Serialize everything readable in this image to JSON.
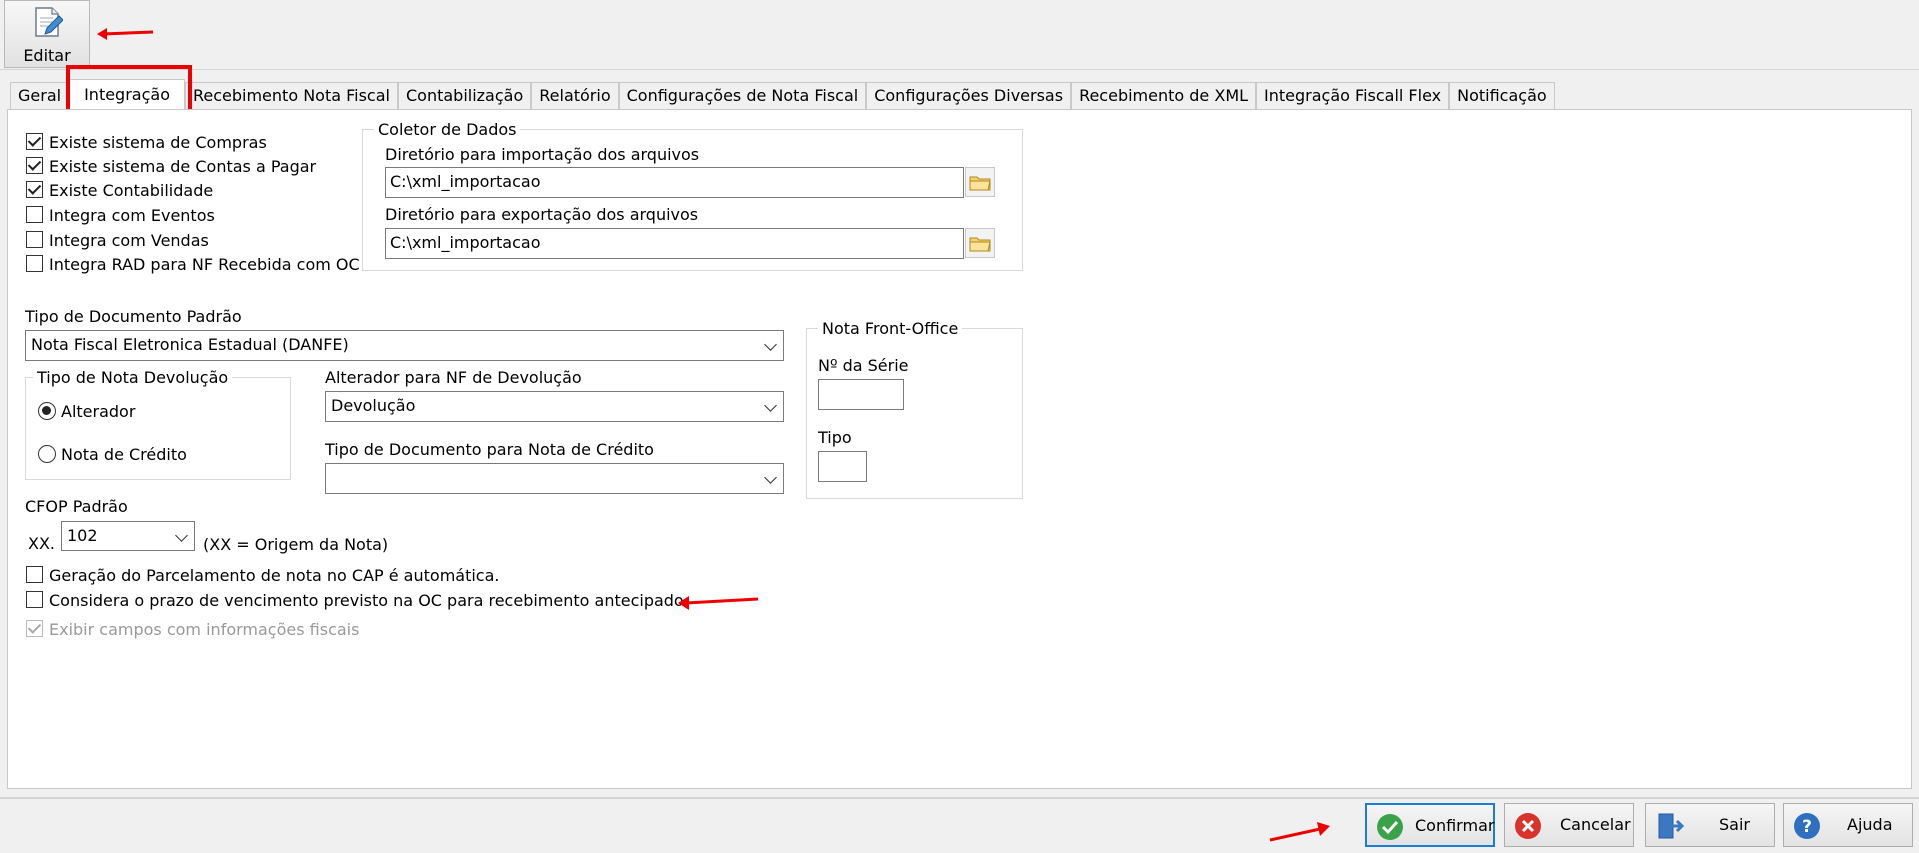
{
  "toolbar": {
    "edit_label": "Editar"
  },
  "tabs": [
    "Geral",
    "Integração",
    "Recebimento Nota Fiscal",
    "Contabilização",
    "Relatório",
    "Configurações de Nota Fiscal",
    "Configurações Diversas",
    "Recebimento de XML",
    "Integração Fiscall Flex",
    "Notificação"
  ],
  "checks": [
    {
      "label": "Existe sistema de Compras",
      "checked": true
    },
    {
      "label": "Existe sistema de Contas a Pagar",
      "checked": true
    },
    {
      "label": "Existe Contabilidade",
      "checked": true
    },
    {
      "label": "Integra com Eventos",
      "checked": false
    },
    {
      "label": "Integra com Vendas",
      "checked": false
    },
    {
      "label": "Integra RAD para NF Recebida com OC",
      "checked": false
    }
  ],
  "coletor": {
    "legend": "Coletor de Dados",
    "import_label": "Diretório para importação dos arquivos",
    "import_value": "C:\\xml_importacao",
    "export_label": "Diretório para exportação dos arquivos",
    "export_value": "C:\\xml_importacao"
  },
  "tipo_doc": {
    "label": "Tipo de Documento Padrão",
    "value": "Nota Fiscal Eletronica Estadual (DANFE)"
  },
  "devolucao": {
    "legend": "Tipo de Nota Devolução",
    "opt1": "Alterador",
    "opt2": "Nota de Crédito",
    "alterador_label": "Alterador para NF de Devolução",
    "alterador_value": "Devolução",
    "tipo_credito_label": "Tipo de Documento para Nota de Crédito",
    "tipo_credito_value": ""
  },
  "front_office": {
    "legend": "Nota Front-Office",
    "serie_label": "Nº da Série",
    "tipo_label": "Tipo"
  },
  "cfop": {
    "label": "CFOP Padrão",
    "prefix": "XX.",
    "value": "102",
    "note": "(XX = Origem da Nota)"
  },
  "bottom_checks": [
    {
      "label": "Geração do Parcelamento de nota no CAP é automática.",
      "checked": false
    },
    {
      "label": "Considera o prazo de vencimento previsto na OC para recebimento antecipado.",
      "checked": false
    },
    {
      "label": "Exibir campos com informações fiscais",
      "checked": true,
      "disabled": true
    }
  ],
  "buttons": {
    "confirm": "Confirmar",
    "cancel": "Cancelar",
    "exit": "Sair",
    "help": "Ajuda"
  },
  "colors": {
    "annotation": "#e00000",
    "accent": "#1a7fd2"
  }
}
